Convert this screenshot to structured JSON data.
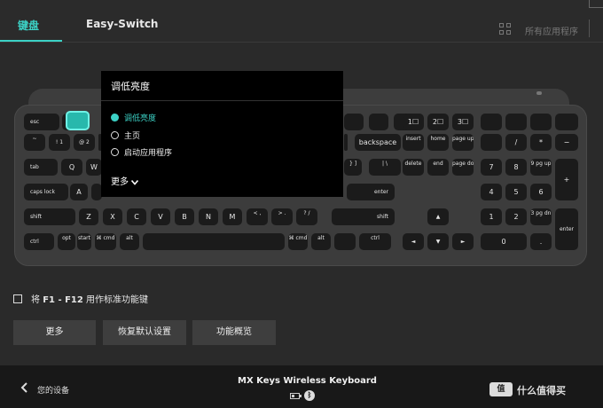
{
  "tabs": {
    "keyboard": "键盘",
    "easy_switch": "Easy-Switch"
  },
  "app_selector": "所有应用程序",
  "colors": {
    "accent": "#3cd2c6",
    "background": "#2a2a2a",
    "key": "#1b1b1b"
  },
  "icons": {
    "grid": "grid-icon",
    "back": "chevron-left-icon",
    "more_chevron": "chevron-down-icon",
    "battery": "battery-icon",
    "bluetooth": "bluetooth-icon"
  },
  "keyboard_keys": {
    "esc": "esc",
    "backspace": "backspace",
    "insert": "insert",
    "home": "home",
    "page_up": "page up",
    "page_down": "page down",
    "delete": "delete",
    "end": "end",
    "tab": "tab",
    "caps": "caps lock",
    "enter": "enter",
    "shift": "shift",
    "ctrl": "ctrl",
    "opt": "opt",
    "start": "start",
    "cmd": "cmd",
    "alt": "alt",
    "Q": "Q",
    "W": "W",
    "A": "A",
    "Z": "Z",
    "X": "X",
    "C": "C",
    "V": "V",
    "B": "B",
    "N": "N",
    "M": "M",
    "lt": "<",
    "gt": ">",
    "qmark": "?",
    "tilde": "~",
    "one": "1",
    "two": "2",
    "bang": "!",
    "at": "@",
    "zero": "0",
    "dot": ".",
    "slash": "/",
    "star": "*",
    "minus": "−",
    "plus": "+",
    "equals": "=",
    "n4": "4",
    "n5": "5",
    "n6": "6",
    "n1": "1",
    "n2": "2",
    "n3": "3",
    "n7": "7",
    "n8": "8",
    "n9": "9",
    "numpad_pgup": "pg up",
    "numpad_pgdn": "pg dn",
    "up_arrow": "▲",
    "down_arrow": "▼",
    "left_arrow": "◄",
    "right_arrow": "►",
    "f1_dev": "1☐",
    "f2_dev": "2☐",
    "f3_dev": "3☐",
    "comma_lt": ",",
    "period_gt": ".",
    "slash_q": "/",
    "pipe": "|",
    "backslash": "\\",
    "brace": "}",
    "bracket": "]",
    "kbd_glyph": "⌘",
    "opt_glyph": "⌥",
    "hash": "#",
    "three": "3",
    "five": "5",
    "percent": "%"
  },
  "popup": {
    "title": "调低亮度",
    "options": [
      "调低亮度",
      "主页",
      "启动应用程序"
    ],
    "selected_index": 0,
    "more": "更多"
  },
  "checkbox": {
    "checked": false,
    "label_prefix": "将",
    "label_keys": "F1 - F12",
    "label_suffix": "用作标准功能键"
  },
  "buttons": {
    "more": "更多",
    "restore": "恢复默认设置",
    "overview": "功能概览"
  },
  "bottom": {
    "back_label": "您的设备",
    "device_name": "MX Keys Wireless Keyboard",
    "watermark_brand": "值",
    "watermark": "什么值得买"
  }
}
